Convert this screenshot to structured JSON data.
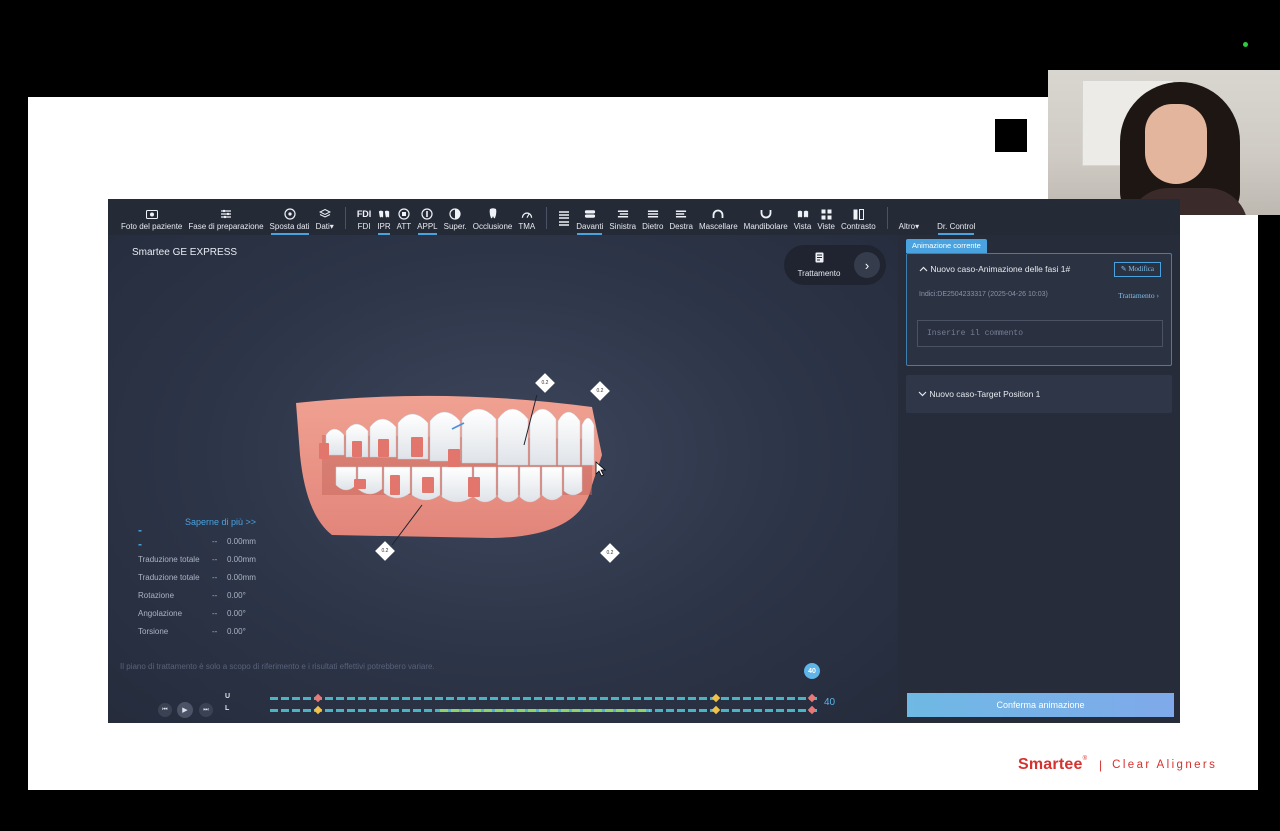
{
  "toolbar": {
    "items": [
      {
        "label": "Foto del paziente",
        "icon": "photo-icon"
      },
      {
        "label": "Fase di preparazione",
        "icon": "list-settings-icon"
      },
      {
        "label": "Sposta dati",
        "icon": "move-icon"
      },
      {
        "label": "Dati",
        "icon": "layers-icon"
      },
      {
        "label": "FDI",
        "icon_text": "FDI"
      },
      {
        "label": "IPR",
        "icon": "teeth-pair-icon"
      },
      {
        "label": "ATT",
        "icon": "attachment-icon"
      },
      {
        "label": "APPL",
        "icon": "appliance-icon"
      },
      {
        "label": "Super.",
        "icon": "half-circle-icon"
      },
      {
        "label": "Occlusione",
        "icon": "tooth-icon"
      },
      {
        "label": "TMA",
        "icon": "gauge-icon"
      },
      {
        "label": "",
        "icon": "stack-icon"
      },
      {
        "label": "Davanti",
        "icon": "front-view-icon"
      },
      {
        "label": "Sinistra",
        "icon": "left-view-icon"
      },
      {
        "label": "Dietro",
        "icon": "back-view-icon"
      },
      {
        "label": "Destra",
        "icon": "right-view-icon"
      },
      {
        "label": "Mascellare",
        "icon": "upper-arch-icon"
      },
      {
        "label": "Mandibolare",
        "icon": "lower-arch-icon"
      },
      {
        "label": "Vista",
        "icon": "view-icon"
      },
      {
        "label": "Viste",
        "icon": "grid-icon"
      },
      {
        "label": "Contrasto",
        "icon": "contrast-icon"
      },
      {
        "label": "Altro",
        "icon": "more-icon"
      },
      {
        "label": "Dr. Control",
        "icon": ""
      }
    ],
    "fdi_text": "FDI",
    "dropdown_arrow": "▾"
  },
  "viewport": {
    "case_title": "Smartee GE EXPRESS",
    "treatment_button": "Trattamento",
    "markers": [
      "0.2",
      "0.2",
      "0.2",
      "0.2"
    ],
    "learn_more": "Saperne di più >>",
    "dash": "--",
    "metrics": [
      {
        "label": "",
        "dash": "--",
        "value": "0.00mm"
      },
      {
        "label": "Traduzione totale",
        "dash": "--",
        "value": "0.00mm"
      },
      {
        "label": "Traduzione totale",
        "dash": "--",
        "value": "0.00mm"
      },
      {
        "label": "Rotazione",
        "dash": "--",
        "value": "0.00°"
      },
      {
        "label": "Angolazione",
        "dash": "--",
        "value": "0.00°"
      },
      {
        "label": "Torsione",
        "dash": "--",
        "value": "0.00°"
      }
    ],
    "disclaimer": "Il piano di trattamento è solo a scopo di riferimento e i risultati effettivi potrebbero variare."
  },
  "timeline": {
    "upper_label": "U",
    "lower_label": "L",
    "current_step": "40",
    "total_steps": "40",
    "controls": [
      "prev-step",
      "play",
      "next-step"
    ]
  },
  "panel": {
    "tag": "Animazione corrente",
    "card1": {
      "title": "Nuovo caso-Animazione delle fasi 1#",
      "modify": "Modifica",
      "indici": "Indici:DE2504233317 (2025-04-26 10:03)",
      "treatment_link": "Trattamento",
      "comment_placeholder": "Inserire il commento"
    },
    "card2": {
      "title": "Nuovo caso-Target Position 1"
    },
    "confirm": "Conferma animazione"
  },
  "brand": {
    "name": "Smartee",
    "reg": "®",
    "separator": "|",
    "tagline": "Clear Aligners"
  },
  "colors": {
    "accent": "#4aa3df",
    "brand_red": "#d6322f",
    "app_bg": "#2a3040"
  }
}
